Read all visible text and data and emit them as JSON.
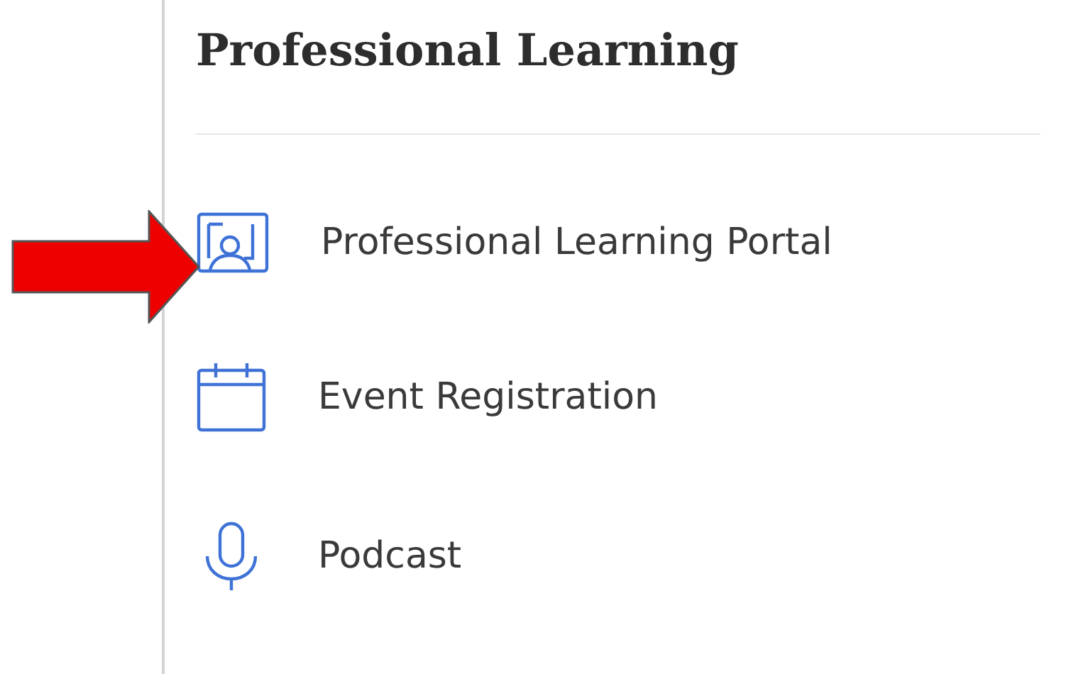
{
  "section": {
    "title": "Professional Learning",
    "items": [
      {
        "label": "Professional Learning Portal",
        "highlighted": true
      },
      {
        "label": "Event Registration",
        "highlighted": false
      },
      {
        "label": "Podcast",
        "highlighted": false
      }
    ]
  }
}
